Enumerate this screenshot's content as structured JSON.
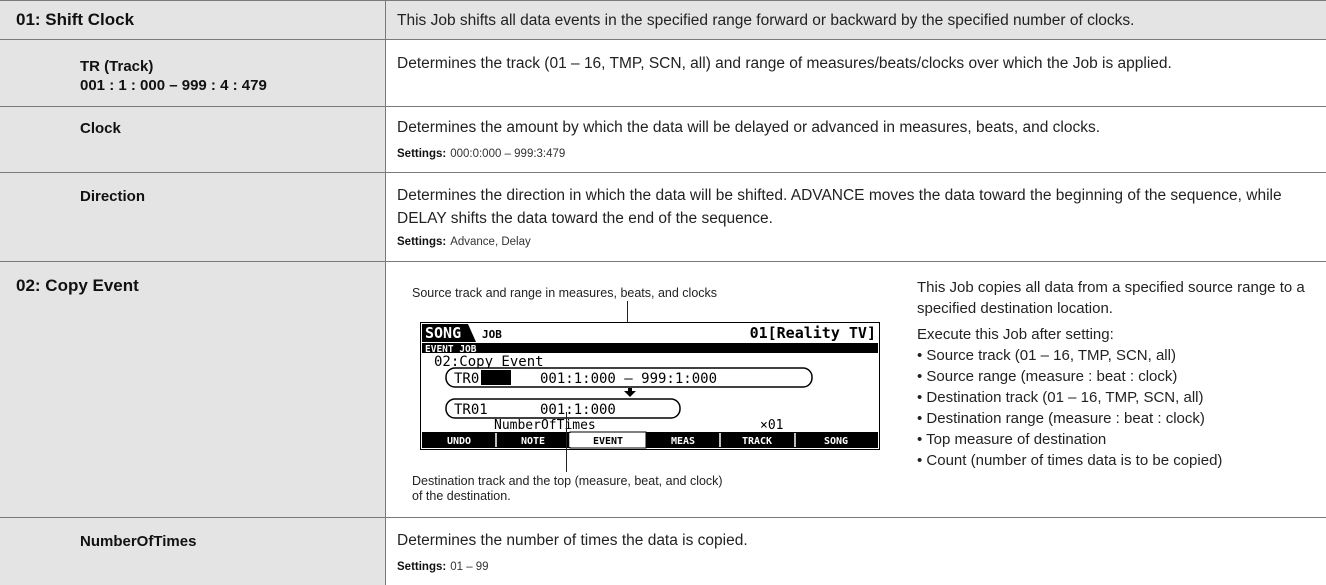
{
  "rows": {
    "shift_clock": {
      "title": "01: Shift Clock",
      "description": "This Job shifts all data events in the specified range forward or backward by the specified number of clocks."
    },
    "tr_track": {
      "title_line1": "TR (Track)",
      "title_line2": "001 : 1 : 000 – 999 : 4 : 479",
      "description": "Determines the track (01 – 16, TMP, SCN, all) and range of measures/beats/clocks over which the Job is applied."
    },
    "clock": {
      "title": "Clock",
      "description": "Determines the amount by which the data will be delayed or advanced in measures, beats, and clocks.",
      "settings_label": "Settings:",
      "settings_value": "000:0:000 – 999:3:479"
    },
    "direction": {
      "title": "Direction",
      "description": "Determines the direction in which the data will be shifted. ADVANCE moves the data toward the beginning of the sequence, while DELAY shifts the data toward the end of the sequence.",
      "settings_label": "Settings:",
      "settings_value": "Advance, Delay"
    },
    "copy_event": {
      "title": "02: Copy Event",
      "caption_top": "Source track and range in measures, beats, and clocks",
      "caption_bottom_line1": "Destination track and the top (measure, beat, and clock)",
      "caption_bottom_line2": "of the destination.",
      "intro": "This Job copies all data from a specified source range to a specified destination location.",
      "execute": "Execute this Job after setting:",
      "bullets": [
        "• Source track (01 – 16, TMP, SCN, all)",
        "• Source range (measure : beat : clock)",
        "• Destination track (01 – 16, TMP, SCN, all)",
        "• Destination range (measure : beat : clock)",
        "• Top measure of destination",
        "• Count (number of times data is to be copied)"
      ]
    },
    "number_of_times": {
      "title": "NumberOfTimes",
      "description": "Determines the number of times the data is copied.",
      "settings_label": "Settings:",
      "settings_value": "01 – 99"
    }
  },
  "lcd": {
    "mode": "SONG",
    "job": "JOB",
    "song_name": "01[Reality TV]",
    "sub": "EVENT JOB",
    "job_name": "02:Copy Event",
    "src_track": "TR01",
    "src_range": "001:1:000 – 999:1:000",
    "dst_track": "TR01",
    "dst_pos": "001:1:000",
    "times_label": "NumberOfTimes",
    "times_value": "×01",
    "tabs": [
      "UNDO",
      "NOTE",
      "EVENT",
      "MEAS",
      "TRACK",
      "SONG"
    ]
  }
}
